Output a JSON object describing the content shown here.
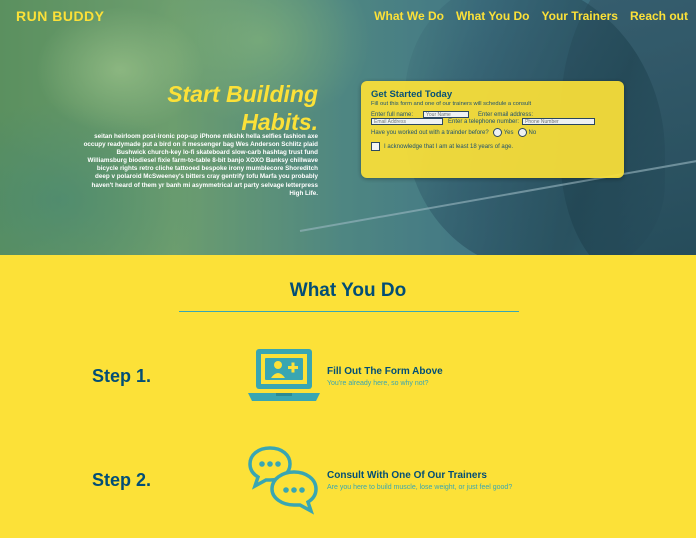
{
  "header": {
    "brand": "RUN BUDDY",
    "nav": [
      "What We Do",
      "What You Do",
      "Your Trainers",
      "Reach out"
    ]
  },
  "hero": {
    "headline_line1": "Start Building",
    "headline_line2": "Habits.",
    "blurb": "seitan heirloom post-ironic pop-up iPhone mlkshk hella selfies fashion axe occupy readymade put a bird on it messenger bag Wes Anderson Schlitz plaid Bushwick church-key lo-fi skateboard slow-carb hashtag trust fund Williamsburg biodiesel fixie farm-to-table 8-bit banjo XOXO Banksy chillwave bicycle rights retro cliche tattooed bespoke irony mumblecore Shoreditch deep v polaroid McSweeney's bitters cray gentrify tofu Marfa you probably haven't heard of them yr banh mi asymmetrical art party selvage letterpress High Life."
  },
  "form": {
    "title": "Get Started Today",
    "subtitle": "Fill out this form and one of our trainers will schedule a consult",
    "name_label": "Enter full name:",
    "name_placeholder": "Your Name",
    "email_label": "Enter email address:",
    "email_placeholder": "Email Address",
    "phone_label": "Enter a telephone number:",
    "phone_placeholder": "Phone Number",
    "worked_question": "Have you worked out with a trainder before?",
    "yes_label": "Yes",
    "no_label": "No",
    "ack_label": "I acknowledge that I am at least 18 years of age."
  },
  "what_you_do": {
    "title": "What You Do",
    "steps": [
      {
        "label": "Step 1.",
        "title": "Fill Out The Form Above",
        "desc": "You're already here, so why not?",
        "icon": "laptop-add-user-icon"
      },
      {
        "label": "Step 2.",
        "title": "Consult With One Of Our Trainers",
        "desc": "Are you here to build muscle, lose weight, or just feel good?",
        "icon": "chat-bubbles-icon"
      }
    ]
  },
  "colors": {
    "accent_yellow": "#fce138",
    "dark_blue": "#024e76",
    "teal": "#39a6b2"
  }
}
